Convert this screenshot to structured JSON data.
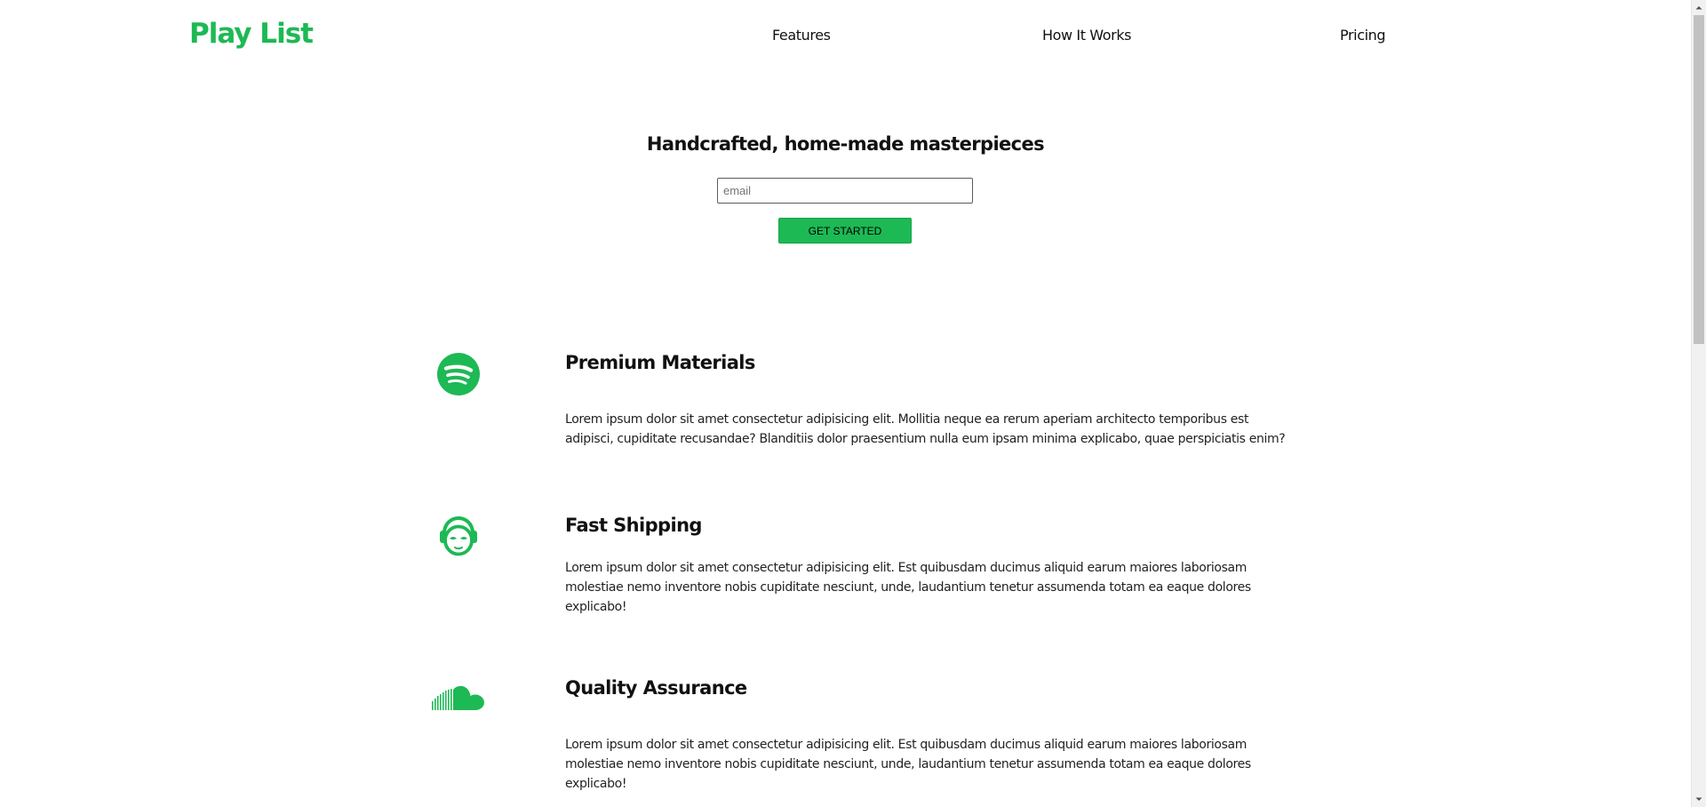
{
  "header": {
    "logo": "Play List",
    "nav": {
      "features": "Features",
      "how_it_works": "How It Works",
      "pricing": "Pricing"
    }
  },
  "hero": {
    "title": "Handcrafted, home-made masterpieces",
    "email_placeholder": "email",
    "cta_label": "GET STARTED"
  },
  "features": [
    {
      "icon": "spotify-icon",
      "title": "Premium Materials",
      "text": "Lorem ipsum dolor sit amet consectetur adipisicing elit. Mollitia neque ea rerum aperiam architecto temporibus est adipisci, cupiditate recusandae? Blanditiis dolor praesentium nulla eum ipsam minima explicabo, quae perspiciatis enim?"
    },
    {
      "icon": "napster-icon",
      "title": "Fast Shipping",
      "text": "Lorem ipsum dolor sit amet consectetur adipisicing elit. Est quibusdam ducimus aliquid earum maiores laboriosam molestiae nemo inventore nobis cupiditate nesciunt, unde, laudantium tenetur assumenda totam ea eaque dolores explicabo!"
    },
    {
      "icon": "soundcloud-icon",
      "title": "Quality Assurance",
      "text": "Lorem ipsum dolor sit amet consectetur adipisicing elit. Est quibusdam ducimus aliquid earum maiores laboriosam molestiae nemo inventore nobis cupiditate nesciunt, unde, laudantium tenetur assumenda totam ea eaque dolores explicabo!"
    }
  ],
  "colors": {
    "accent": "#1db954",
    "text": "#111111",
    "background": "#ffffff"
  }
}
